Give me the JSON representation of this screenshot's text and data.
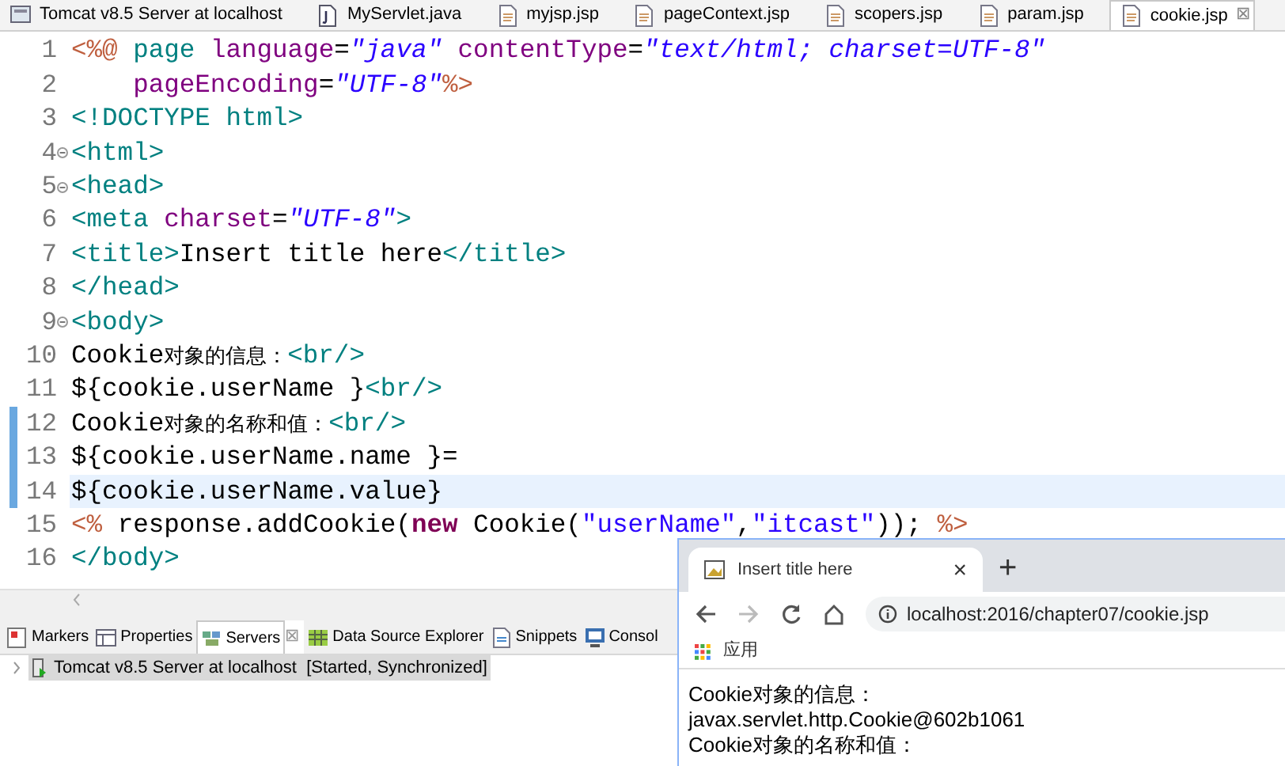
{
  "editor_tabs": [
    {
      "label": "Tomcat v8.5 Server at localhost",
      "kind": "server",
      "selected": false
    },
    {
      "label": "MyServlet.java",
      "kind": "java",
      "selected": false
    },
    {
      "label": "myjsp.jsp",
      "kind": "jsp",
      "selected": false
    },
    {
      "label": "pageContext.jsp",
      "kind": "jsp",
      "selected": false
    },
    {
      "label": "scopers.jsp",
      "kind": "jsp",
      "selected": false
    },
    {
      "label": "param.jsp",
      "kind": "jsp",
      "selected": false
    },
    {
      "label": "cookie.jsp",
      "kind": "jsp",
      "selected": true,
      "close": "⊠"
    }
  ],
  "code_lines": [
    {
      "number": "1",
      "fold": false,
      "changed": false,
      "current": false,
      "tokens": [
        {
          "kind": "directive",
          "text": "<%@"
        },
        {
          "kind": "tag",
          "text": " page"
        },
        {
          "kind": "attr",
          "text": " language"
        },
        {
          "kind": "plain",
          "text": "="
        },
        {
          "kind": "string",
          "text": "\"java\""
        },
        {
          "kind": "attr",
          "text": " contentType"
        },
        {
          "kind": "plain",
          "text": "="
        },
        {
          "kind": "string",
          "text": "\"text/html; charset=UTF-8\""
        }
      ]
    },
    {
      "number": "2",
      "fold": false,
      "changed": false,
      "current": false,
      "tokens": [
        {
          "kind": "attr",
          "text": "    pageEncoding"
        },
        {
          "kind": "plain",
          "text": "="
        },
        {
          "kind": "string",
          "text": "\"UTF-8\""
        },
        {
          "kind": "directive",
          "text": "%>"
        }
      ]
    },
    {
      "number": "3",
      "fold": false,
      "changed": false,
      "current": false,
      "tokens": [
        {
          "kind": "tag",
          "text": "<!DOCTYPE html>"
        }
      ]
    },
    {
      "number": "4",
      "fold": true,
      "changed": false,
      "current": false,
      "tokens": [
        {
          "kind": "tag",
          "text": "<html>"
        }
      ]
    },
    {
      "number": "5",
      "fold": true,
      "changed": false,
      "current": false,
      "tokens": [
        {
          "kind": "tag",
          "text": "<head>"
        }
      ]
    },
    {
      "number": "6",
      "fold": false,
      "changed": false,
      "current": false,
      "tokens": [
        {
          "kind": "tag",
          "text": "<meta"
        },
        {
          "kind": "attr",
          "text": " charset"
        },
        {
          "kind": "plain",
          "text": "="
        },
        {
          "kind": "string",
          "text": "\"UTF-8\""
        },
        {
          "kind": "tag",
          "text": ">"
        }
      ]
    },
    {
      "number": "7",
      "fold": false,
      "changed": false,
      "current": false,
      "tokens": [
        {
          "kind": "tag",
          "text": "<title>"
        },
        {
          "kind": "text",
          "text": "Insert title here"
        },
        {
          "kind": "tag",
          "text": "</title>"
        }
      ]
    },
    {
      "number": "8",
      "fold": false,
      "changed": false,
      "current": false,
      "tokens": [
        {
          "kind": "tag",
          "text": "</head>"
        }
      ]
    },
    {
      "number": "9",
      "fold": true,
      "changed": false,
      "current": false,
      "tokens": [
        {
          "kind": "tag",
          "text": "<body>"
        }
      ]
    },
    {
      "number": "10",
      "fold": false,
      "changed": false,
      "current": false,
      "tokens": [
        {
          "kind": "text",
          "text": "Cookie"
        },
        {
          "kind": "cjk",
          "text": "对象的信息："
        },
        {
          "kind": "tag",
          "text": "<br/>"
        }
      ]
    },
    {
      "number": "11",
      "fold": false,
      "changed": false,
      "current": false,
      "tokens": [
        {
          "kind": "text",
          "text": "${cookie.userName }"
        },
        {
          "kind": "tag",
          "text": "<br/>"
        }
      ]
    },
    {
      "number": "12",
      "fold": false,
      "changed": true,
      "current": false,
      "tokens": [
        {
          "kind": "text",
          "text": "Cookie"
        },
        {
          "kind": "cjk",
          "text": "对象的名称和值："
        },
        {
          "kind": "tag",
          "text": "<br/>"
        }
      ]
    },
    {
      "number": "13",
      "fold": false,
      "changed": true,
      "current": false,
      "tokens": [
        {
          "kind": "text",
          "text": "${cookie.userName.name }="
        }
      ]
    },
    {
      "number": "14",
      "fold": false,
      "changed": true,
      "current": true,
      "tokens": [
        {
          "kind": "text",
          "text": "${cookie.userName.value}"
        }
      ]
    },
    {
      "number": "15",
      "fold": false,
      "changed": false,
      "current": false,
      "tokens": [
        {
          "kind": "directive",
          "text": "<%"
        },
        {
          "kind": "text",
          "text": " response.addCookie("
        },
        {
          "kind": "keyword",
          "text": "new"
        },
        {
          "kind": "text",
          "text": " Cookie("
        },
        {
          "kind": "jstring",
          "text": "\"userName\""
        },
        {
          "kind": "text",
          "text": ","
        },
        {
          "kind": "jstring",
          "text": "\"itcast\""
        },
        {
          "kind": "text",
          "text": ")); "
        },
        {
          "kind": "directive",
          "text": "%>"
        }
      ]
    },
    {
      "number": "16",
      "fold": false,
      "changed": false,
      "current": false,
      "tokens": [
        {
          "kind": "tag",
          "text": "</body>"
        }
      ]
    }
  ],
  "panel_tabs": [
    {
      "label": "Markers",
      "kind": "markers",
      "selected": false
    },
    {
      "label": "Properties",
      "kind": "properties",
      "selected": false
    },
    {
      "label": "Servers",
      "kind": "servers",
      "selected": true,
      "close": "⊠"
    },
    {
      "label": "Data Source Explorer",
      "kind": "datasource",
      "selected": false
    },
    {
      "label": "Snippets",
      "kind": "snippets",
      "selected": false
    },
    {
      "label": "Consol",
      "kind": "console",
      "selected": false
    }
  ],
  "servers": [
    {
      "name": "Tomcat v8.5 Server at localhost",
      "state": "[Started, Synchronized]",
      "selected": true,
      "expanded": false
    }
  ],
  "browser": {
    "tab_title": "Insert title here",
    "tab_close": "×",
    "new_tab": "+",
    "forward_disabled": true,
    "url": "localhost:2016/chapter07/cookie.jsp",
    "bookmark": "应用",
    "content": [
      "Cookie对象的信息：",
      "javax.servlet.http.Cookie@602b1061",
      "Cookie对象的名称和值："
    ]
  }
}
